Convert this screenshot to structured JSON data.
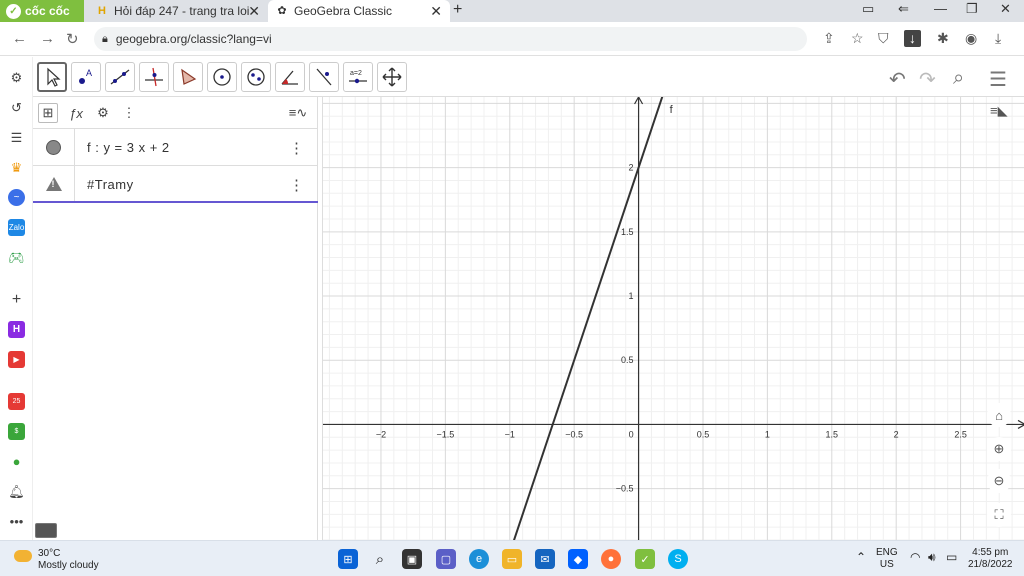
{
  "browser": {
    "brand": "cốc cốc",
    "tabs": [
      {
        "label": "Hỏi đáp 247 - trang tra loi",
        "active": false
      },
      {
        "label": "GeoGebra Classic",
        "active": true
      }
    ],
    "url": "geogebra.org/classic?lang=vi"
  },
  "algebra": {
    "rows": [
      {
        "expr": "f : y = 3 x + 2"
      },
      {
        "expr": "#Tramy"
      }
    ]
  },
  "graph": {
    "function_label": "f",
    "x_ticks": [
      "−2",
      "−1.5",
      "−1",
      "−0.5",
      "0",
      "0.5",
      "1",
      "1.5",
      "2",
      "2.5"
    ],
    "y_ticks": [
      "2",
      "1.5",
      "1",
      "0.5",
      "−0.5"
    ],
    "line_color": "#333333"
  },
  "chart_data": {
    "type": "line",
    "xlim": [
      -2.45,
      3.0
    ],
    "ylim": [
      -0.9,
      2.55
    ],
    "grid": true,
    "series": [
      {
        "name": "f",
        "equation": "y = 3 x + 2",
        "x": [
          -1.0,
          0.2
        ],
        "y": [
          -1.0,
          2.6
        ]
      }
    ]
  },
  "taskbar": {
    "weather_temp": "30°C",
    "weather_desc": "Mostly cloudy",
    "lang_top": "ENG",
    "lang_bottom": "US",
    "time": "4:55 pm",
    "date": "21/8/2022"
  }
}
